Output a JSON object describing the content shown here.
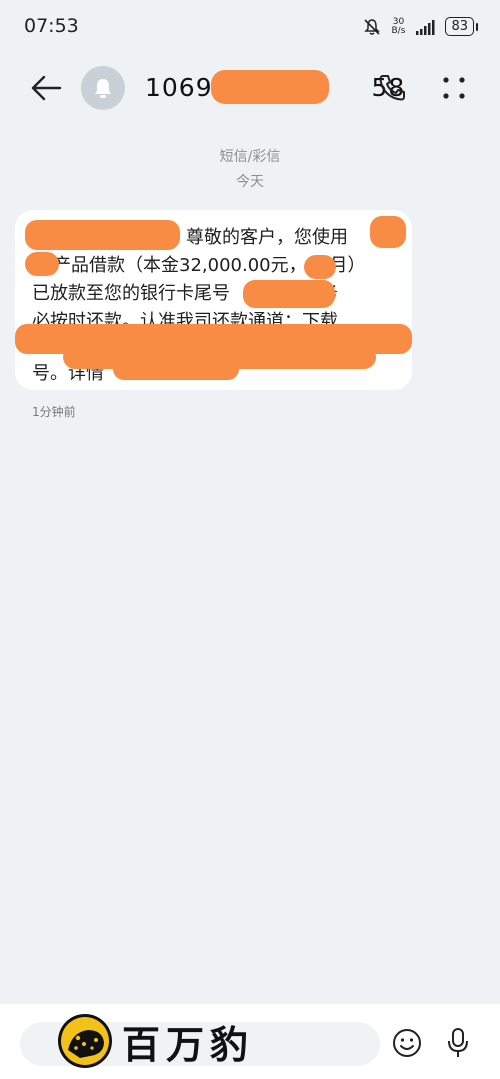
{
  "status_bar": {
    "time": "07:53",
    "net_speed_top": "30",
    "net_speed_bottom": "B/s",
    "battery": "83"
  },
  "header": {
    "sender_visible_start": "10691",
    "sender_visible_end": "58"
  },
  "thread": {
    "sms_type": "短信/彩信",
    "date": "今天"
  },
  "message": {
    "lines": [
      "尊敬的客户，您使用",
      "产品借款（本金32,000.00元，12月）",
      "已放款至您的银行卡尾号　　　　请务",
      "必按时还款。认准我司还款通道：下载",
      "",
      "号。详情"
    ],
    "timestamp": "1分钟前"
  },
  "watermark": {
    "text": "百万豹"
  },
  "colors": {
    "redaction": "#f98c44",
    "background": "#eff2f4"
  }
}
